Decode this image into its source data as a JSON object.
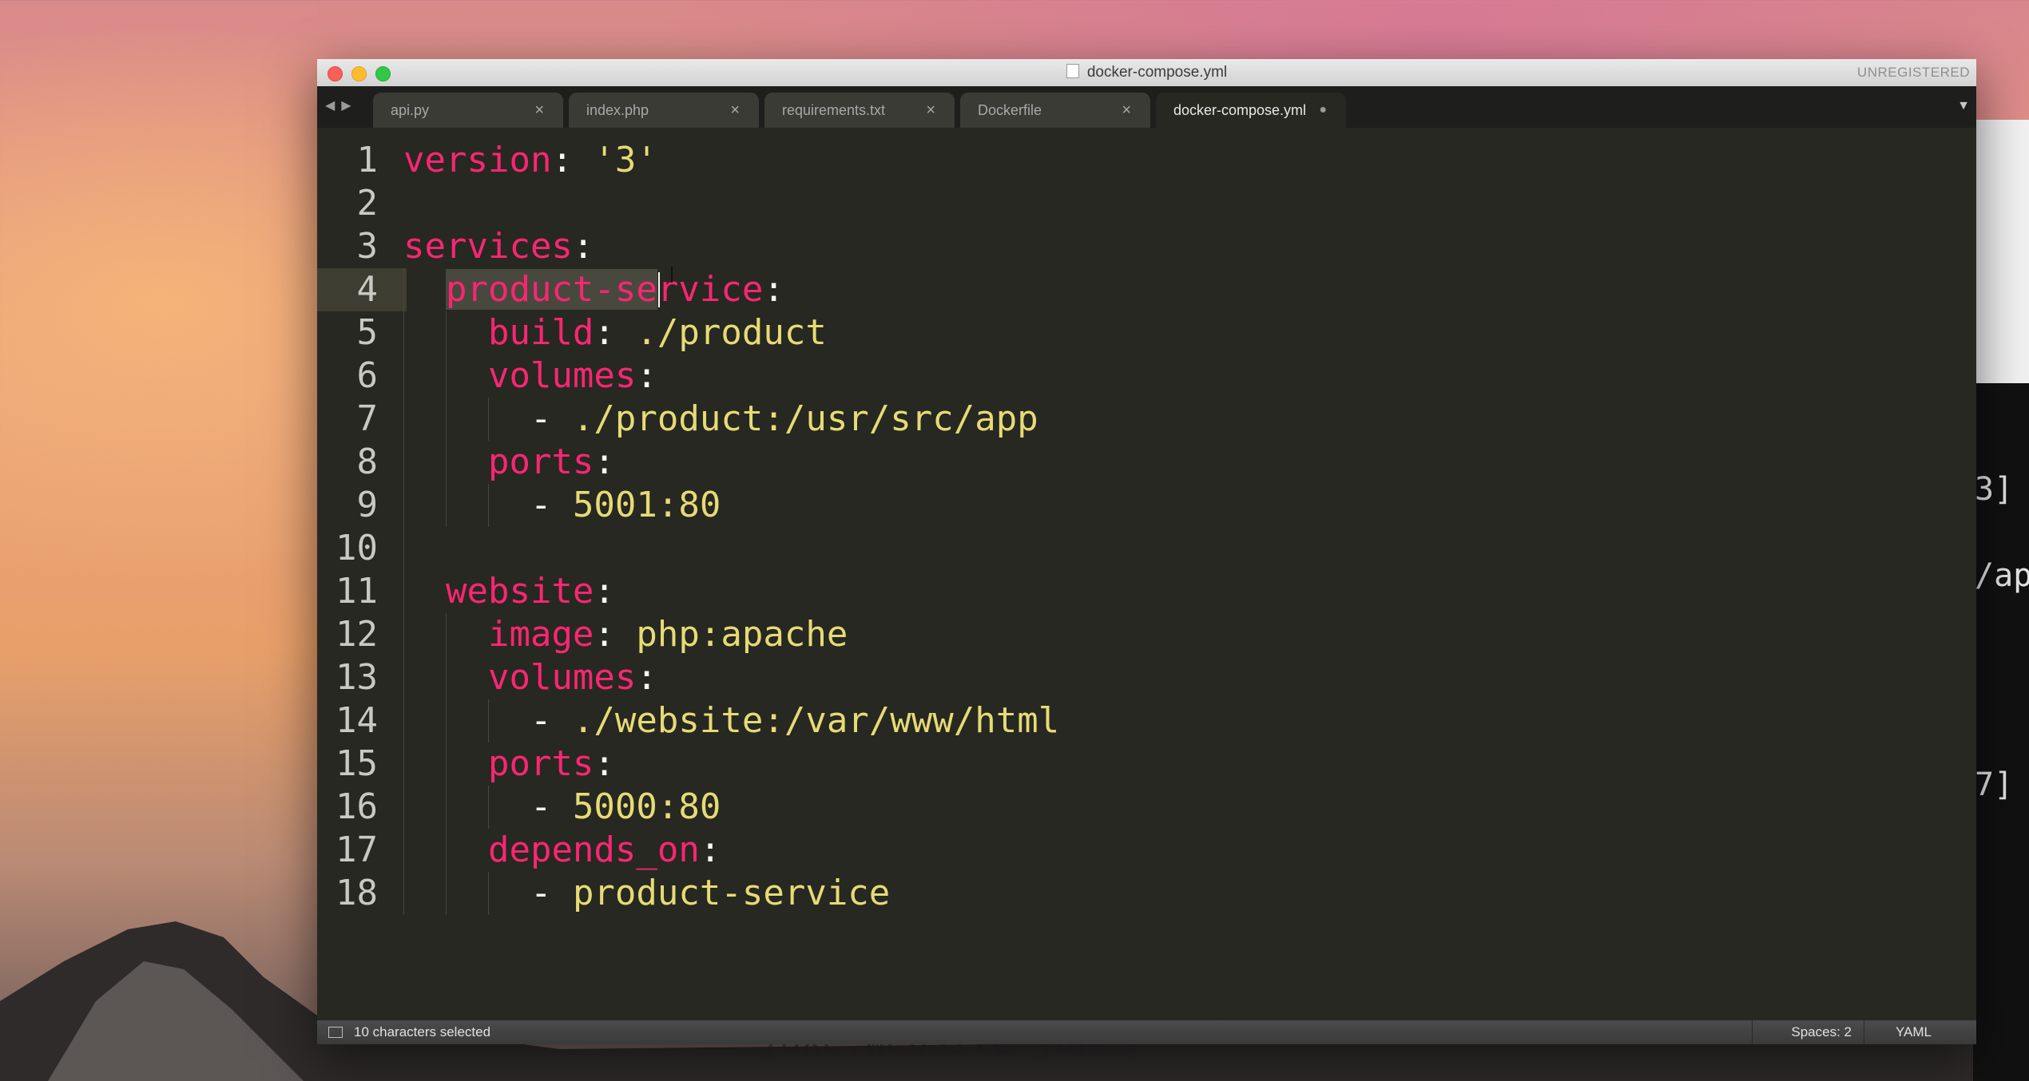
{
  "window": {
    "title": "docker-compose.yml",
    "unregistered": "UNREGISTERED"
  },
  "tabs": [
    {
      "label": "api.py",
      "close": "×"
    },
    {
      "label": "index.php",
      "close": "×"
    },
    {
      "label": "requirements.txt",
      "close": "×"
    },
    {
      "label": "Dockerfile",
      "close": "×"
    },
    {
      "label": "docker-compose.yml",
      "close": "●",
      "active": true
    }
  ],
  "editor": {
    "current_line": 4,
    "lines": [
      {
        "n": "1",
        "tokens": [
          [
            "k",
            "version"
          ],
          [
            "p",
            ": "
          ],
          [
            "s",
            "'3'"
          ]
        ]
      },
      {
        "n": "2",
        "tokens": []
      },
      {
        "n": "3",
        "tokens": [
          [
            "k",
            "services"
          ],
          [
            "p",
            ":"
          ]
        ]
      },
      {
        "n": "4",
        "tokens": [
          [
            "p",
            "  "
          ],
          [
            "k",
            "product-se"
          ],
          [
            "k",
            "rvice"
          ],
          [
            "p",
            ":"
          ]
        ]
      },
      {
        "n": "5",
        "tokens": [
          [
            "p",
            "    "
          ],
          [
            "k",
            "build"
          ],
          [
            "p",
            ": "
          ],
          [
            "s",
            "./product"
          ]
        ]
      },
      {
        "n": "6",
        "tokens": [
          [
            "p",
            "    "
          ],
          [
            "k",
            "volumes"
          ],
          [
            "p",
            ":"
          ]
        ]
      },
      {
        "n": "7",
        "tokens": [
          [
            "p",
            "      "
          ],
          [
            "p",
            "- "
          ],
          [
            "s",
            "./product:/usr/src/app"
          ]
        ]
      },
      {
        "n": "8",
        "tokens": [
          [
            "p",
            "    "
          ],
          [
            "k",
            "ports"
          ],
          [
            "p",
            ":"
          ]
        ]
      },
      {
        "n": "9",
        "tokens": [
          [
            "p",
            "      "
          ],
          [
            "p",
            "- "
          ],
          [
            "s",
            "5001:80"
          ]
        ]
      },
      {
        "n": "10",
        "tokens": []
      },
      {
        "n": "11",
        "tokens": [
          [
            "p",
            "  "
          ],
          [
            "k",
            "website"
          ],
          [
            "p",
            ":"
          ]
        ]
      },
      {
        "n": "12",
        "tokens": [
          [
            "p",
            "    "
          ],
          [
            "k",
            "image"
          ],
          [
            "p",
            ": "
          ],
          [
            "s",
            "php:apache"
          ]
        ]
      },
      {
        "n": "13",
        "tokens": [
          [
            "p",
            "    "
          ],
          [
            "k",
            "volumes"
          ],
          [
            "p",
            ":"
          ]
        ]
      },
      {
        "n": "14",
        "tokens": [
          [
            "p",
            "      "
          ],
          [
            "p",
            "- "
          ],
          [
            "s",
            "./website:/var/www/html"
          ]
        ]
      },
      {
        "n": "15",
        "tokens": [
          [
            "p",
            "    "
          ],
          [
            "k",
            "ports"
          ],
          [
            "p",
            ":"
          ]
        ]
      },
      {
        "n": "16",
        "tokens": [
          [
            "p",
            "      "
          ],
          [
            "p",
            "- "
          ],
          [
            "s",
            "5000:80"
          ]
        ]
      },
      {
        "n": "17",
        "tokens": [
          [
            "p",
            "    "
          ],
          [
            "k",
            "depends_on"
          ],
          [
            "p",
            ":"
          ]
        ]
      },
      {
        "n": "18",
        "tokens": [
          [
            "p",
            "      "
          ],
          [
            "p",
            "- "
          ],
          [
            "s",
            "product-service"
          ]
        ]
      }
    ]
  },
  "status": {
    "selection": "10 characters selected",
    "spaces": "Spaces: 2",
    "syntax": "YAML"
  },
  "background_terminal": {
    "fragments": [
      "3]",
      "/ap",
      "7]"
    ],
    "behind_text": "jake:website jake$"
  },
  "colors": {
    "editor_bg": "#272822",
    "keyword": "#f92672",
    "string": "#e6db74",
    "plain": "#f8f8f2",
    "selection": "#49483e"
  }
}
